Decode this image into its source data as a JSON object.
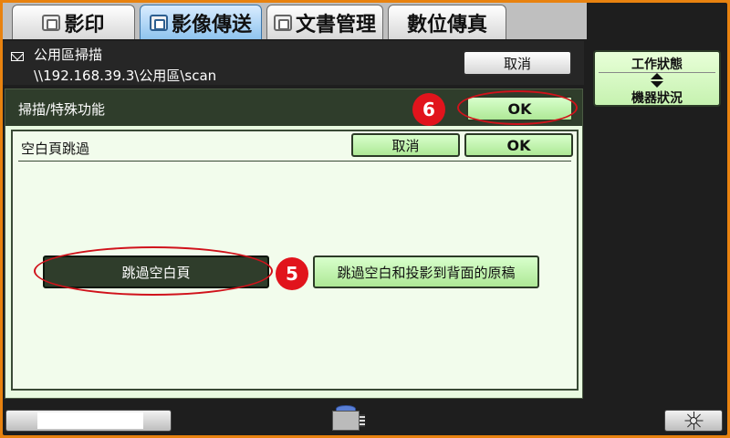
{
  "tabs": [
    {
      "label": "影印",
      "icon": "copy-icon",
      "active": false
    },
    {
      "label": "影像傳送",
      "icon": "image-send-icon",
      "active": true
    },
    {
      "label": "文書管理",
      "icon": "document-filing-icon",
      "active": false
    },
    {
      "label": "數位傳真",
      "icon": "",
      "active": false
    }
  ],
  "destination": {
    "title": "公用區掃描",
    "path": "\\\\192.168.39.3\\公用區\\scan",
    "icon": "mail-icon",
    "cancel_label": "取消"
  },
  "panel": {
    "title": "掃描/特殊功能",
    "ok_label": "OK"
  },
  "subpanel": {
    "title": "空白頁跳過",
    "cancel_label": "取消",
    "ok_label": "OK",
    "options": [
      {
        "label": "跳過空白頁",
        "selected": true
      },
      {
        "label": "跳過空白和投影到背面的原稿",
        "selected": false
      }
    ]
  },
  "annotations": [
    {
      "number": "6"
    },
    {
      "number": "5"
    }
  ],
  "status": {
    "top_label": "工作狀態",
    "bottom_label": "機器狀況",
    "icon": "updown-arrow-icon"
  },
  "footer": {
    "device_icon": "device-icon",
    "right_icon": "brightness-icon"
  },
  "colors": {
    "frame": "#e8820f",
    "panel_dark": "#2f3d2b",
    "button_green": "#aee896",
    "callout_red": "#e1141c"
  }
}
